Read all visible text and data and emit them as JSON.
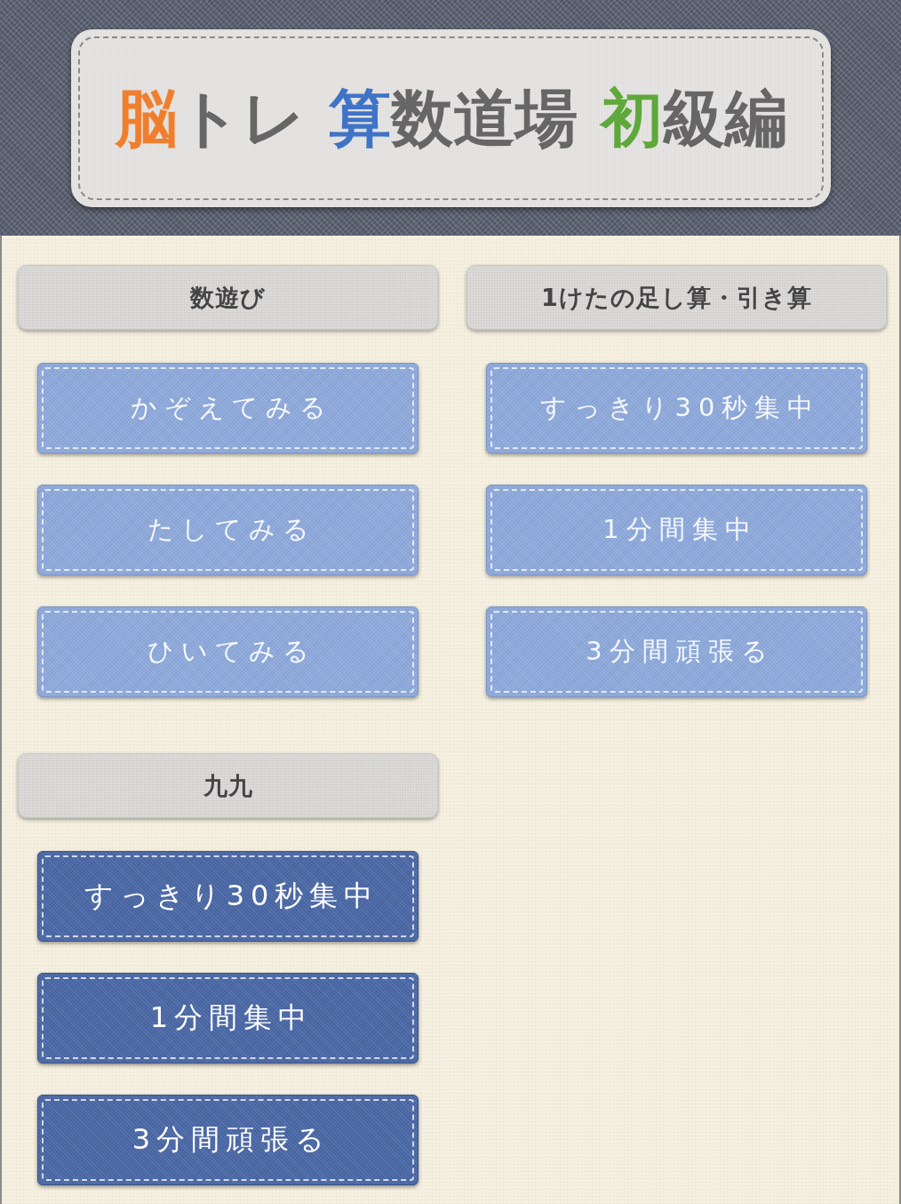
{
  "title": {
    "words": [
      {
        "accent": "脳",
        "rest": "トレ",
        "color": "#ef7f2e"
      },
      {
        "accent": "算",
        "rest": "数道場",
        "color": "#3f73c8"
      },
      {
        "accent": "初",
        "rest": "級編",
        "color": "#5fa83c"
      }
    ]
  },
  "sections": [
    {
      "title": "数遊び",
      "kind": "light",
      "buttons": [
        "かぞえてみる",
        "たしてみる",
        "ひいてみる"
      ]
    },
    {
      "title": "1けたの足し算・引き算",
      "kind": "light",
      "buttons": [
        "すっきり30秒集中",
        "1分間集中",
        "3分間頑張る"
      ]
    },
    {
      "title": "九九",
      "kind": "dark",
      "buttons": [
        "すっきり30秒集中",
        "1分間集中",
        "3分間頑張る"
      ]
    }
  ]
}
